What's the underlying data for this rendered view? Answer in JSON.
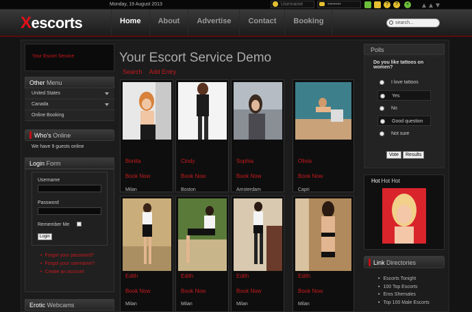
{
  "topbar": {
    "date": "Monday, 19 August 2013",
    "username_placeholder": "Username",
    "password_placeholder": "••••••••"
  },
  "header": {
    "logo_initial": "X",
    "logo_rest": "escorts",
    "nav": [
      "Home",
      "About",
      "Advertise",
      "Contact",
      "Booking"
    ],
    "search_placeholder": "search..."
  },
  "sidebar": {
    "banner": "Your Escort Service",
    "other_menu_title_a": "Other",
    "other_menu_title_b": " Menu",
    "menu_items": [
      "United States",
      "Canada",
      "Online Booking"
    ],
    "whos_online_a": "Who's",
    "whos_online_b": " Online",
    "guests_text": "We have 9 guests online",
    "login_a": "Login",
    "login_b": " Form",
    "username_label": "Username",
    "password_label": "Password",
    "remember_label": "Remember Me",
    "login_button": "Login",
    "links": [
      "Forgot your password?",
      "Forgot your username?",
      "Create an account"
    ],
    "webcams_a": "Erotic",
    "webcams_b": " Webcams"
  },
  "main": {
    "title": "Your Escort Service Demo",
    "subnav": [
      "Search",
      "Add Entry"
    ],
    "book_label": "Book Now",
    "cards": [
      {
        "name": "Bonita",
        "city": "Milan"
      },
      {
        "name": "Cindy",
        "city": "Boston"
      },
      {
        "name": "Sophia",
        "city": "Amsterdam"
      },
      {
        "name": "Olivia",
        "city": "Capri"
      },
      {
        "name": "Edith",
        "city": "Milan"
      },
      {
        "name": "Edith",
        "city": "Milan"
      },
      {
        "name": "Edith",
        "city": "Milan"
      },
      {
        "name": "Edith",
        "city": "Milan"
      }
    ]
  },
  "right": {
    "polls_title": "Polls",
    "poll_question": "Do you like tattoos on women?",
    "options": [
      "I love tattoos",
      "Yes",
      "No",
      "Good question",
      "Not sure"
    ],
    "vote_button": "Vote",
    "results_button": "Results",
    "hot_a": "Hot",
    "hot_b": " Hot Hot",
    "links_a": "Link",
    "links_b": " Directories",
    "link_items": [
      "Escorts Tonight",
      "100 Top Escorts",
      "Eros Shemales",
      "Top 100 Male Escorts"
    ]
  }
}
